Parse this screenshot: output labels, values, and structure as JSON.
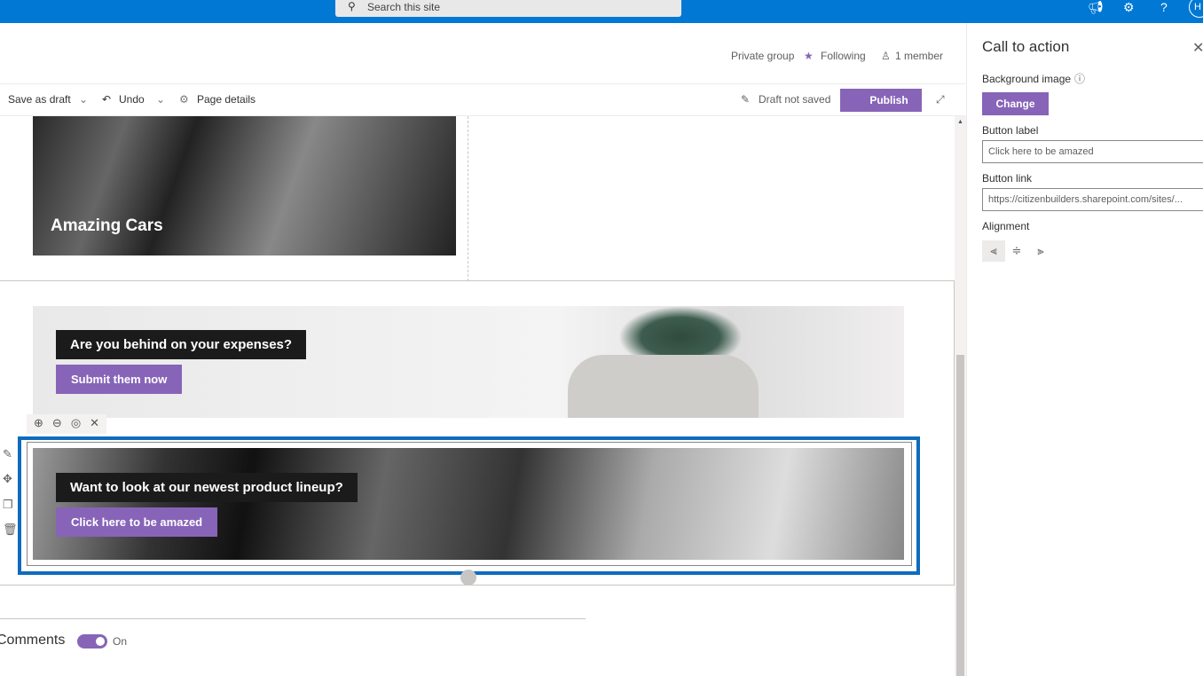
{
  "topbar": {
    "search_placeholder": "Search this site",
    "avatar": "H"
  },
  "group": {
    "privacy": "Private group",
    "following": "Following",
    "members": "1 member"
  },
  "commandbar": {
    "save_draft": "Save as draft",
    "undo": "Undo",
    "page_details": "Page details",
    "draft_status": "Draft not saved",
    "publish": "Publish"
  },
  "content": {
    "card_title": "Amazing Cars",
    "cta1": {
      "heading": "Are you behind on your expenses?",
      "button": "Submit them now"
    },
    "cta2": {
      "heading": "Want to look at our newest product lineup?",
      "button": "Click here to be amazed"
    },
    "comments": {
      "label": "Comments",
      "toggle_state": "On",
      "toggle_on": true
    }
  },
  "panel": {
    "title": "Call to action",
    "background_label": "Background image",
    "change": "Change",
    "button_label_label": "Button label",
    "button_label_value": "Click here to be amazed",
    "button_link_label": "Button link",
    "button_link_value": "https://citizenbuilders.sharepoint.com/sites/...",
    "alignment_label": "Alignment",
    "alignment_selected": "left"
  },
  "colors": {
    "brand": "#0078d4",
    "accent": "#8764b8",
    "selection": "#0f6cbd"
  }
}
